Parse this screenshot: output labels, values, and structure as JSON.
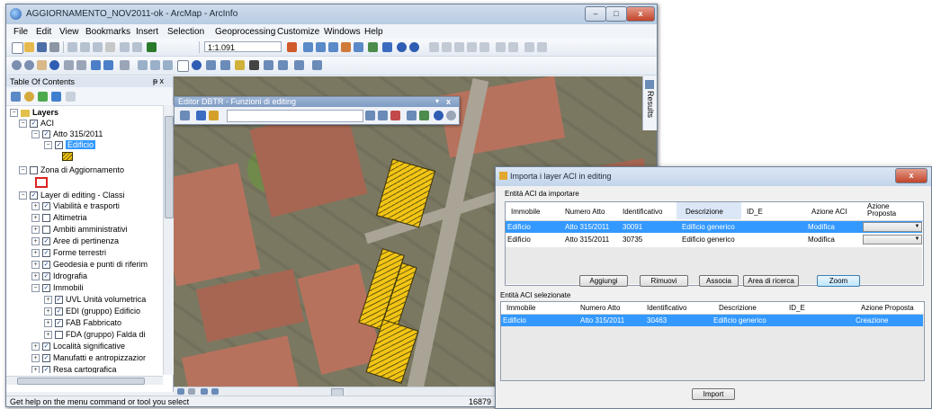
{
  "window": {
    "title": "AGGIORNAMENTO_NOV2011-ok - ArcMap - ArcInfo",
    "minimize": "–",
    "maximize": "□",
    "close": "x"
  },
  "menu": [
    "File",
    "Edit",
    "View",
    "Bookmarks",
    "Insert",
    "Selection",
    "Geoprocessing",
    "Customize",
    "Windows",
    "Help"
  ],
  "toolbar": {
    "scale": "1:1.091"
  },
  "toc": {
    "title": "Table Of Contents",
    "pin": "ᵽ x",
    "layers_root": "Layers",
    "items": [
      {
        "label": "ACI"
      },
      {
        "label": "Atto 315/2011"
      },
      {
        "label": "Edificio"
      },
      {
        "label": "Zona di Aggiornamento"
      },
      {
        "label": "Layer di editing - Classi"
      },
      {
        "label": "Viabilità e trasporti"
      },
      {
        "label": "Altimetria"
      },
      {
        "label": "Ambiti amministrativi"
      },
      {
        "label": "Aree di pertinenza"
      },
      {
        "label": "Forme terrestri"
      },
      {
        "label": "Geodesia e punti di riferim"
      },
      {
        "label": "Idrografia"
      },
      {
        "label": "Immobili"
      },
      {
        "label": "UVL Unità volumetrica"
      },
      {
        "label": "EDI (gruppo) Edificio"
      },
      {
        "label": "FAB Fabbricato"
      },
      {
        "label": "FDA (gruppo) Falda di"
      },
      {
        "label": "Località significative"
      },
      {
        "label": "Manufatti e antropizzazior"
      },
      {
        "label": "Resa cartografica"
      }
    ]
  },
  "editor_toolbar": {
    "title": "Editor DBTR - Funzioni di editing"
  },
  "results_tab": "Results",
  "status": {
    "message": "Get help on the menu command or tool you select",
    "coords": "16879"
  },
  "dialog": {
    "title": "Importa i layer ACI in editing",
    "section1": "Entità ACI da importare",
    "section2": "Entità ACI selezionate",
    "columns1": [
      "Immobile",
      "Numero Atto",
      "Identificativo",
      "Descrizione",
      "ID_E",
      "Azione ACI",
      "Azione Proposta"
    ],
    "rows1": [
      {
        "immobile": "Edificio",
        "atto": "Atto 315/2011",
        "id": "30091",
        "descr": "Edificio generico",
        "id_e": "",
        "azione": "Modifica",
        "proposta": ""
      },
      {
        "immobile": "Edificio",
        "atto": "Atto 315/2011",
        "id": "30735",
        "descr": "Edificio generico",
        "id_e": "",
        "azione": "Modifica",
        "proposta": ""
      }
    ],
    "buttons": {
      "aggiungi": "Aggiungi",
      "rimuovi": "Rimuovi",
      "associa": "Associa",
      "area": "Area di ricerca",
      "zoom": "Zoom",
      "import": "Import"
    },
    "columns2": [
      "Immobile",
      "Numero Atto",
      "Identificativo",
      "Descrizione",
      "ID_E",
      "Azione Proposta"
    ],
    "rows2": [
      {
        "immobile": "Edificio",
        "atto": "Atto 315/2011",
        "id": "30463",
        "descr": "Edificio generico",
        "id_e": "",
        "proposta": "Creazione"
      }
    ],
    "close": "x"
  },
  "colors": {
    "selection": "#3399ff",
    "hatch": "#f2c515",
    "roof": "#b7725d"
  }
}
